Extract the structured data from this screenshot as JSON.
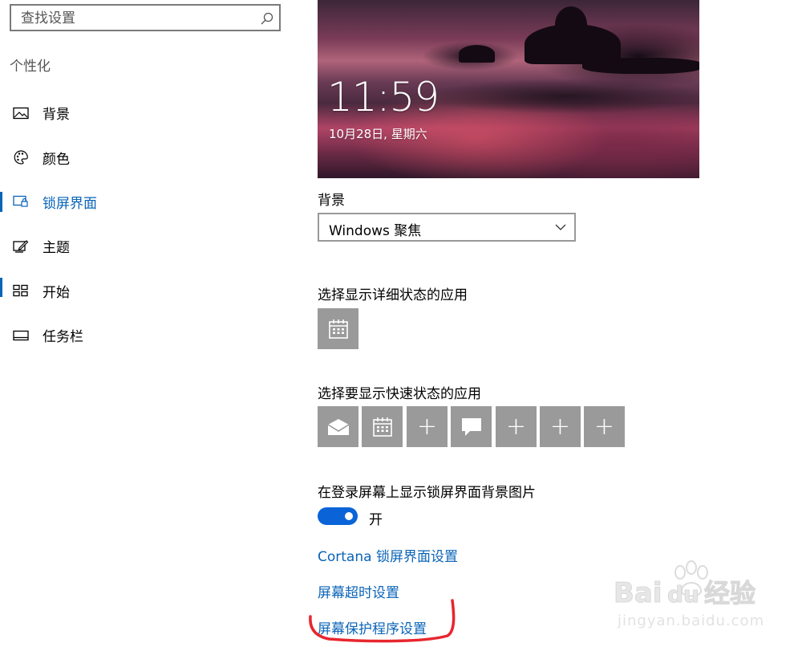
{
  "search": {
    "placeholder": "查找设置"
  },
  "sidebar": {
    "section_title": "个性化",
    "items": [
      {
        "label": "背景",
        "icon": "picture-icon"
      },
      {
        "label": "颜色",
        "icon": "palette-icon"
      },
      {
        "label": "锁屏界面",
        "icon": "lock-screen-icon",
        "active": true
      },
      {
        "label": "主题",
        "icon": "theme-icon"
      },
      {
        "label": "开始",
        "icon": "start-icon"
      },
      {
        "label": "任务栏",
        "icon": "taskbar-icon"
      }
    ]
  },
  "preview": {
    "time": "11:59",
    "date": "10月28日, 星期六"
  },
  "background": {
    "label": "背景",
    "selected": "Windows 聚焦"
  },
  "detailed_status": {
    "label": "选择显示详细状态的应用",
    "app_icon": "calendar-icon"
  },
  "quick_status": {
    "label": "选择要显示快速状态的应用",
    "tiles": [
      "mail-icon",
      "calendar-icon",
      "plus",
      "message-icon",
      "plus",
      "plus",
      "plus"
    ],
    "plus_glyph": "+"
  },
  "login_background": {
    "label": "在登录屏幕上显示锁屏界面背景图片",
    "toggle_state": "开",
    "on": true
  },
  "links": {
    "cortana": "Cortana 锁屏界面设置",
    "timeout": "屏幕超时设置",
    "screensaver": "屏幕保护程序设置"
  },
  "colors": {
    "accent": "#0a64b8",
    "toggle": "#0a64d8",
    "tile": "#9a9a9a",
    "annotation": "#e8262e"
  },
  "watermark": {
    "brand": "Bai du 经验",
    "url": "jingyan.baidu.com"
  }
}
